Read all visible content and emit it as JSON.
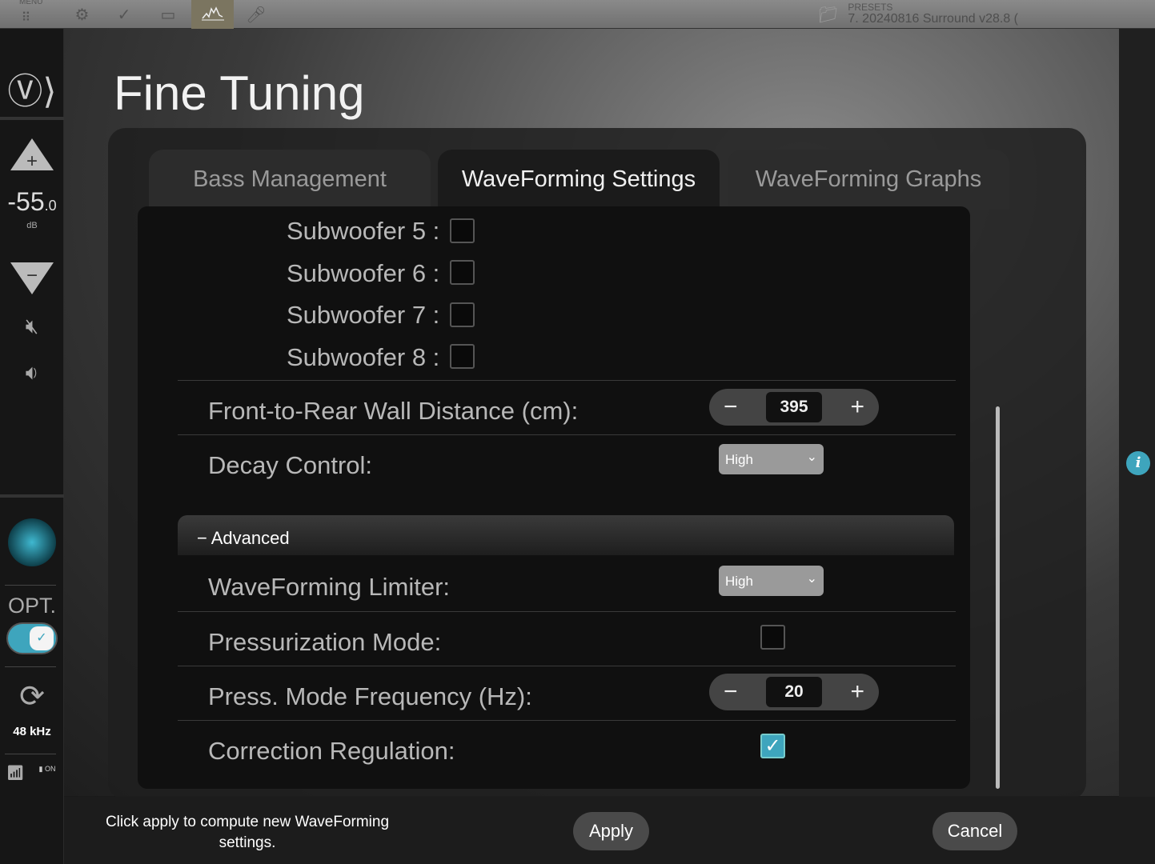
{
  "topbar": {
    "menu_label": "MENU",
    "presets_label": "PRESETS",
    "preset_name": "7. 20240816 Surround v28.8 (",
    "icons": [
      "grid-icon",
      "gear-icon",
      "check-icon",
      "speaker-box-icon",
      "waveform-graph-icon",
      "microphone-icon"
    ],
    "active_icon": "waveform-graph-icon"
  },
  "sidebar": {
    "volume": "-55",
    "volume_decimal": ".0",
    "volume_unit": "dB",
    "opt_label": "OPT.",
    "opt_enabled": true,
    "sample_rate": "48 kHz",
    "mic_status": "ON"
  },
  "page": {
    "title": "Fine Tuning"
  },
  "tabs": [
    {
      "label": "Bass Management"
    },
    {
      "label": "WaveForming Settings",
      "active": true
    },
    {
      "label": "WaveForming Graphs"
    }
  ],
  "subwoofers": [
    {
      "label": "Subwoofer 5 :",
      "checked": false
    },
    {
      "label": "Subwoofer 6 :",
      "checked": false
    },
    {
      "label": "Subwoofer 7 :",
      "checked": false
    },
    {
      "label": "Subwoofer 8 :",
      "checked": false
    }
  ],
  "settings": {
    "wall_distance": {
      "label": "Front-to-Rear Wall Distance (cm):",
      "value": "395"
    },
    "decay": {
      "label": "Decay Control:",
      "value": "High"
    },
    "advanced_label": "Advanced",
    "limiter": {
      "label": "WaveForming Limiter:",
      "value": "High"
    },
    "pressurization": {
      "label": "Pressurization Mode:",
      "checked": false
    },
    "press_freq": {
      "label": "Press. Mode Frequency (Hz):",
      "value": "20"
    },
    "correction": {
      "label": "Correction Regulation:",
      "checked": true
    }
  },
  "footer": {
    "message": "Click apply to compute new WaveForming settings.",
    "apply": "Apply",
    "cancel": "Cancel"
  },
  "colors": {
    "accent": "#3ea5bd",
    "active_toolbar": "#7b7560"
  }
}
